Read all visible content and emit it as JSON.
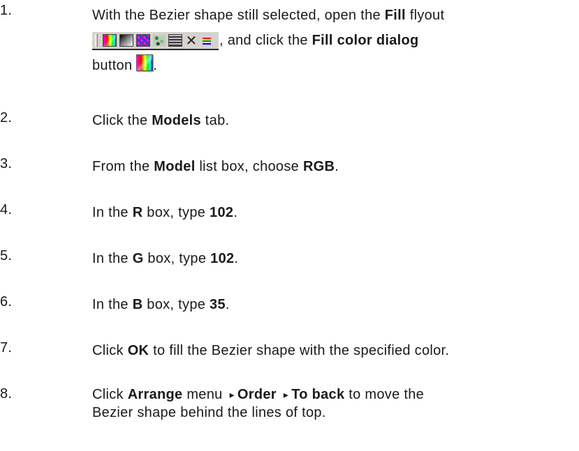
{
  "toolbar": {
    "icons": [
      "color-dialog-icon",
      "fountain-fill-icon",
      "pattern-fill-icon",
      "texture-fill-icon",
      "postscript-fill-icon",
      "no-fill-icon",
      "color-docker-icon"
    ],
    "no_fill_glyph": "✕"
  },
  "steps": [
    {
      "num": "1.",
      "t1": "With the Bezier shape still selected, open the ",
      "b1": "Fill",
      "t2": " flyout",
      "t3": ", and click the ",
      "b2": "Fill color dialog",
      "t4": "button ",
      "t5": "."
    },
    {
      "num": "2.",
      "t1": "Click the ",
      "b1": "Models",
      "t2": " tab."
    },
    {
      "num": "3.",
      "t1": "From the ",
      "b1": "Model",
      "t2": " list box, choose ",
      "b2": "RGB",
      "t3": "."
    },
    {
      "num": "4.",
      "t1": "In the ",
      "b1": "R",
      "t2": " box, type ",
      "b2": "102",
      "t3": "."
    },
    {
      "num": "5.",
      "t1": "In the ",
      "b1": "G",
      "t2": " box, type ",
      "b2": "102",
      "t3": "."
    },
    {
      "num": "6.",
      "t1": "In the ",
      "b1": "B",
      "t2": " box, type ",
      "b2": "35",
      "t3": "."
    },
    {
      "num": "7.",
      "t1": "Click ",
      "b1": "OK",
      "t2": " to fill the Bezier shape with the specified color."
    },
    {
      "num": "8.",
      "t1": "Click ",
      "b1": "Arrange",
      "t2": " menu",
      "sep1": "▸",
      "b2": "Order",
      "sep2": "▸",
      "b3": "To back",
      "t3": " to move the",
      "t4": "Bezier shape behind the lines of top."
    }
  ]
}
